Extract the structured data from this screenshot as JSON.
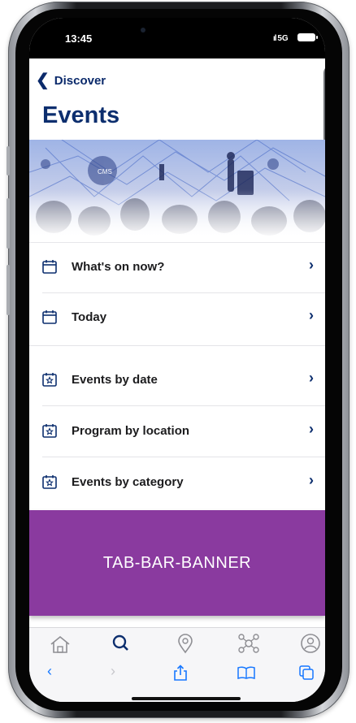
{
  "status_bar": {
    "time": "13:45",
    "network": "5G"
  },
  "nav": {
    "back_label": "Discover"
  },
  "page": {
    "title": "Events"
  },
  "menu": {
    "group1": [
      {
        "label": "What's on now?",
        "icon": "calendar-icon"
      },
      {
        "label": "Today",
        "icon": "calendar-icon"
      }
    ],
    "group2": [
      {
        "label": "Events by date",
        "icon": "calendar-star-icon"
      },
      {
        "label": "Program by location",
        "icon": "calendar-star-icon"
      },
      {
        "label": "Events by category",
        "icon": "calendar-star-icon"
      }
    ]
  },
  "banner": {
    "label": "TAB-BAR-BANNER",
    "color": "#8a3a9f"
  },
  "tab_bar": {
    "icons": [
      "home-icon",
      "search-icon",
      "location-pin-icon",
      "network-icon",
      "profile-icon"
    ],
    "active": "search-icon"
  },
  "browser_bar": {
    "icons": [
      "back-icon",
      "forward-icon",
      "share-icon",
      "bookmarks-icon",
      "tabs-icon"
    ]
  },
  "colors": {
    "accent": "#0c2e6e",
    "link": "#1677ff"
  }
}
